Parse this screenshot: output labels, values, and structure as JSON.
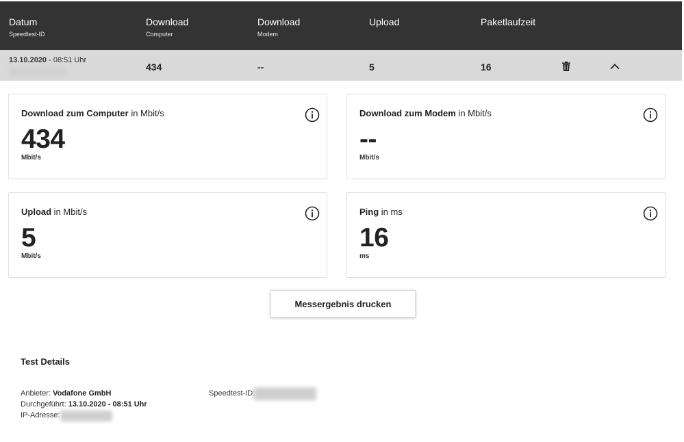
{
  "header": {
    "columns": [
      {
        "title": "Datum",
        "subtitle": "Speedtest-ID"
      },
      {
        "title": "Download",
        "subtitle": "Computer"
      },
      {
        "title": "Download",
        "subtitle": "Modem"
      },
      {
        "title": "Upload",
        "subtitle": ""
      },
      {
        "title": "Paketlaufzeit",
        "subtitle": ""
      }
    ]
  },
  "row": {
    "date": "13.10.2020",
    "time": " - 08:51 Uhr",
    "download_computer": "434",
    "download_modem": "--",
    "upload": "5",
    "ping": "16",
    "icons": {
      "delete": "trash-icon",
      "collapse": "chevron-up-icon"
    }
  },
  "cards": {
    "download_computer": {
      "title": "Download zum Computer",
      "suffix": " in Mbit/s",
      "value": "434",
      "unit": "Mbit/s"
    },
    "download_modem": {
      "title": "Download zum Modem",
      "suffix": " in Mbit/s",
      "value": "--",
      "unit": "Mbit/s"
    },
    "upload": {
      "title": "Upload",
      "suffix": " in Mbit/s",
      "value": "5",
      "unit": "Mbit/s"
    },
    "ping": {
      "title": "Ping",
      "suffix": " in ms",
      "value": "16",
      "unit": "ms"
    }
  },
  "print_button": "Messergebnis drucken",
  "details": {
    "title": "Test Details",
    "provider_label": "Anbieter:",
    "provider_value": "Vodafone GmbH",
    "performed_label": "Durchgeführt:",
    "performed_value": "13.10.2020 - 08:51 Uhr",
    "ip_label": "IP-Adresse:",
    "speedtest_id_label": "Speedtest-ID:"
  }
}
